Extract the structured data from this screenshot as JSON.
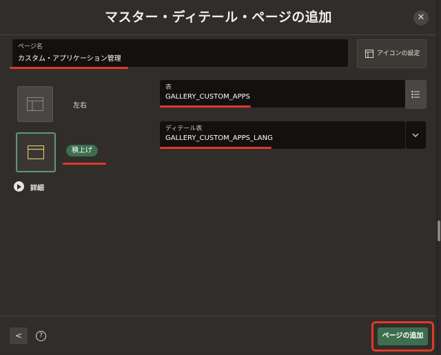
{
  "dialog": {
    "title": "マスター・ディテール・ページの追加",
    "close_symbol": "✕"
  },
  "page_name": {
    "label": "ページ名",
    "value": "カスタム・アプリケーション管理"
  },
  "icon_button": {
    "label": "アイコンの設定"
  },
  "layouts": [
    {
      "label": "左右",
      "selected": false
    },
    {
      "label": "積上げ",
      "selected": true
    }
  ],
  "details_toggle": {
    "label": "詳細"
  },
  "table_field": {
    "label": "表",
    "value": "GALLERY_CUSTOM_APPS"
  },
  "detail_table_field": {
    "label": "ディテール表",
    "value": "GALLERY_CUSTOM_APPS_LANG"
  },
  "footer": {
    "back_symbol": "<",
    "help_symbol": "?",
    "submit_label": "ページの追加"
  },
  "colors": {
    "accent_green": "#3d6e4e",
    "highlight_red": "#e03a2a",
    "field_bg": "#131110",
    "dialog_bg": "#312d2a"
  }
}
